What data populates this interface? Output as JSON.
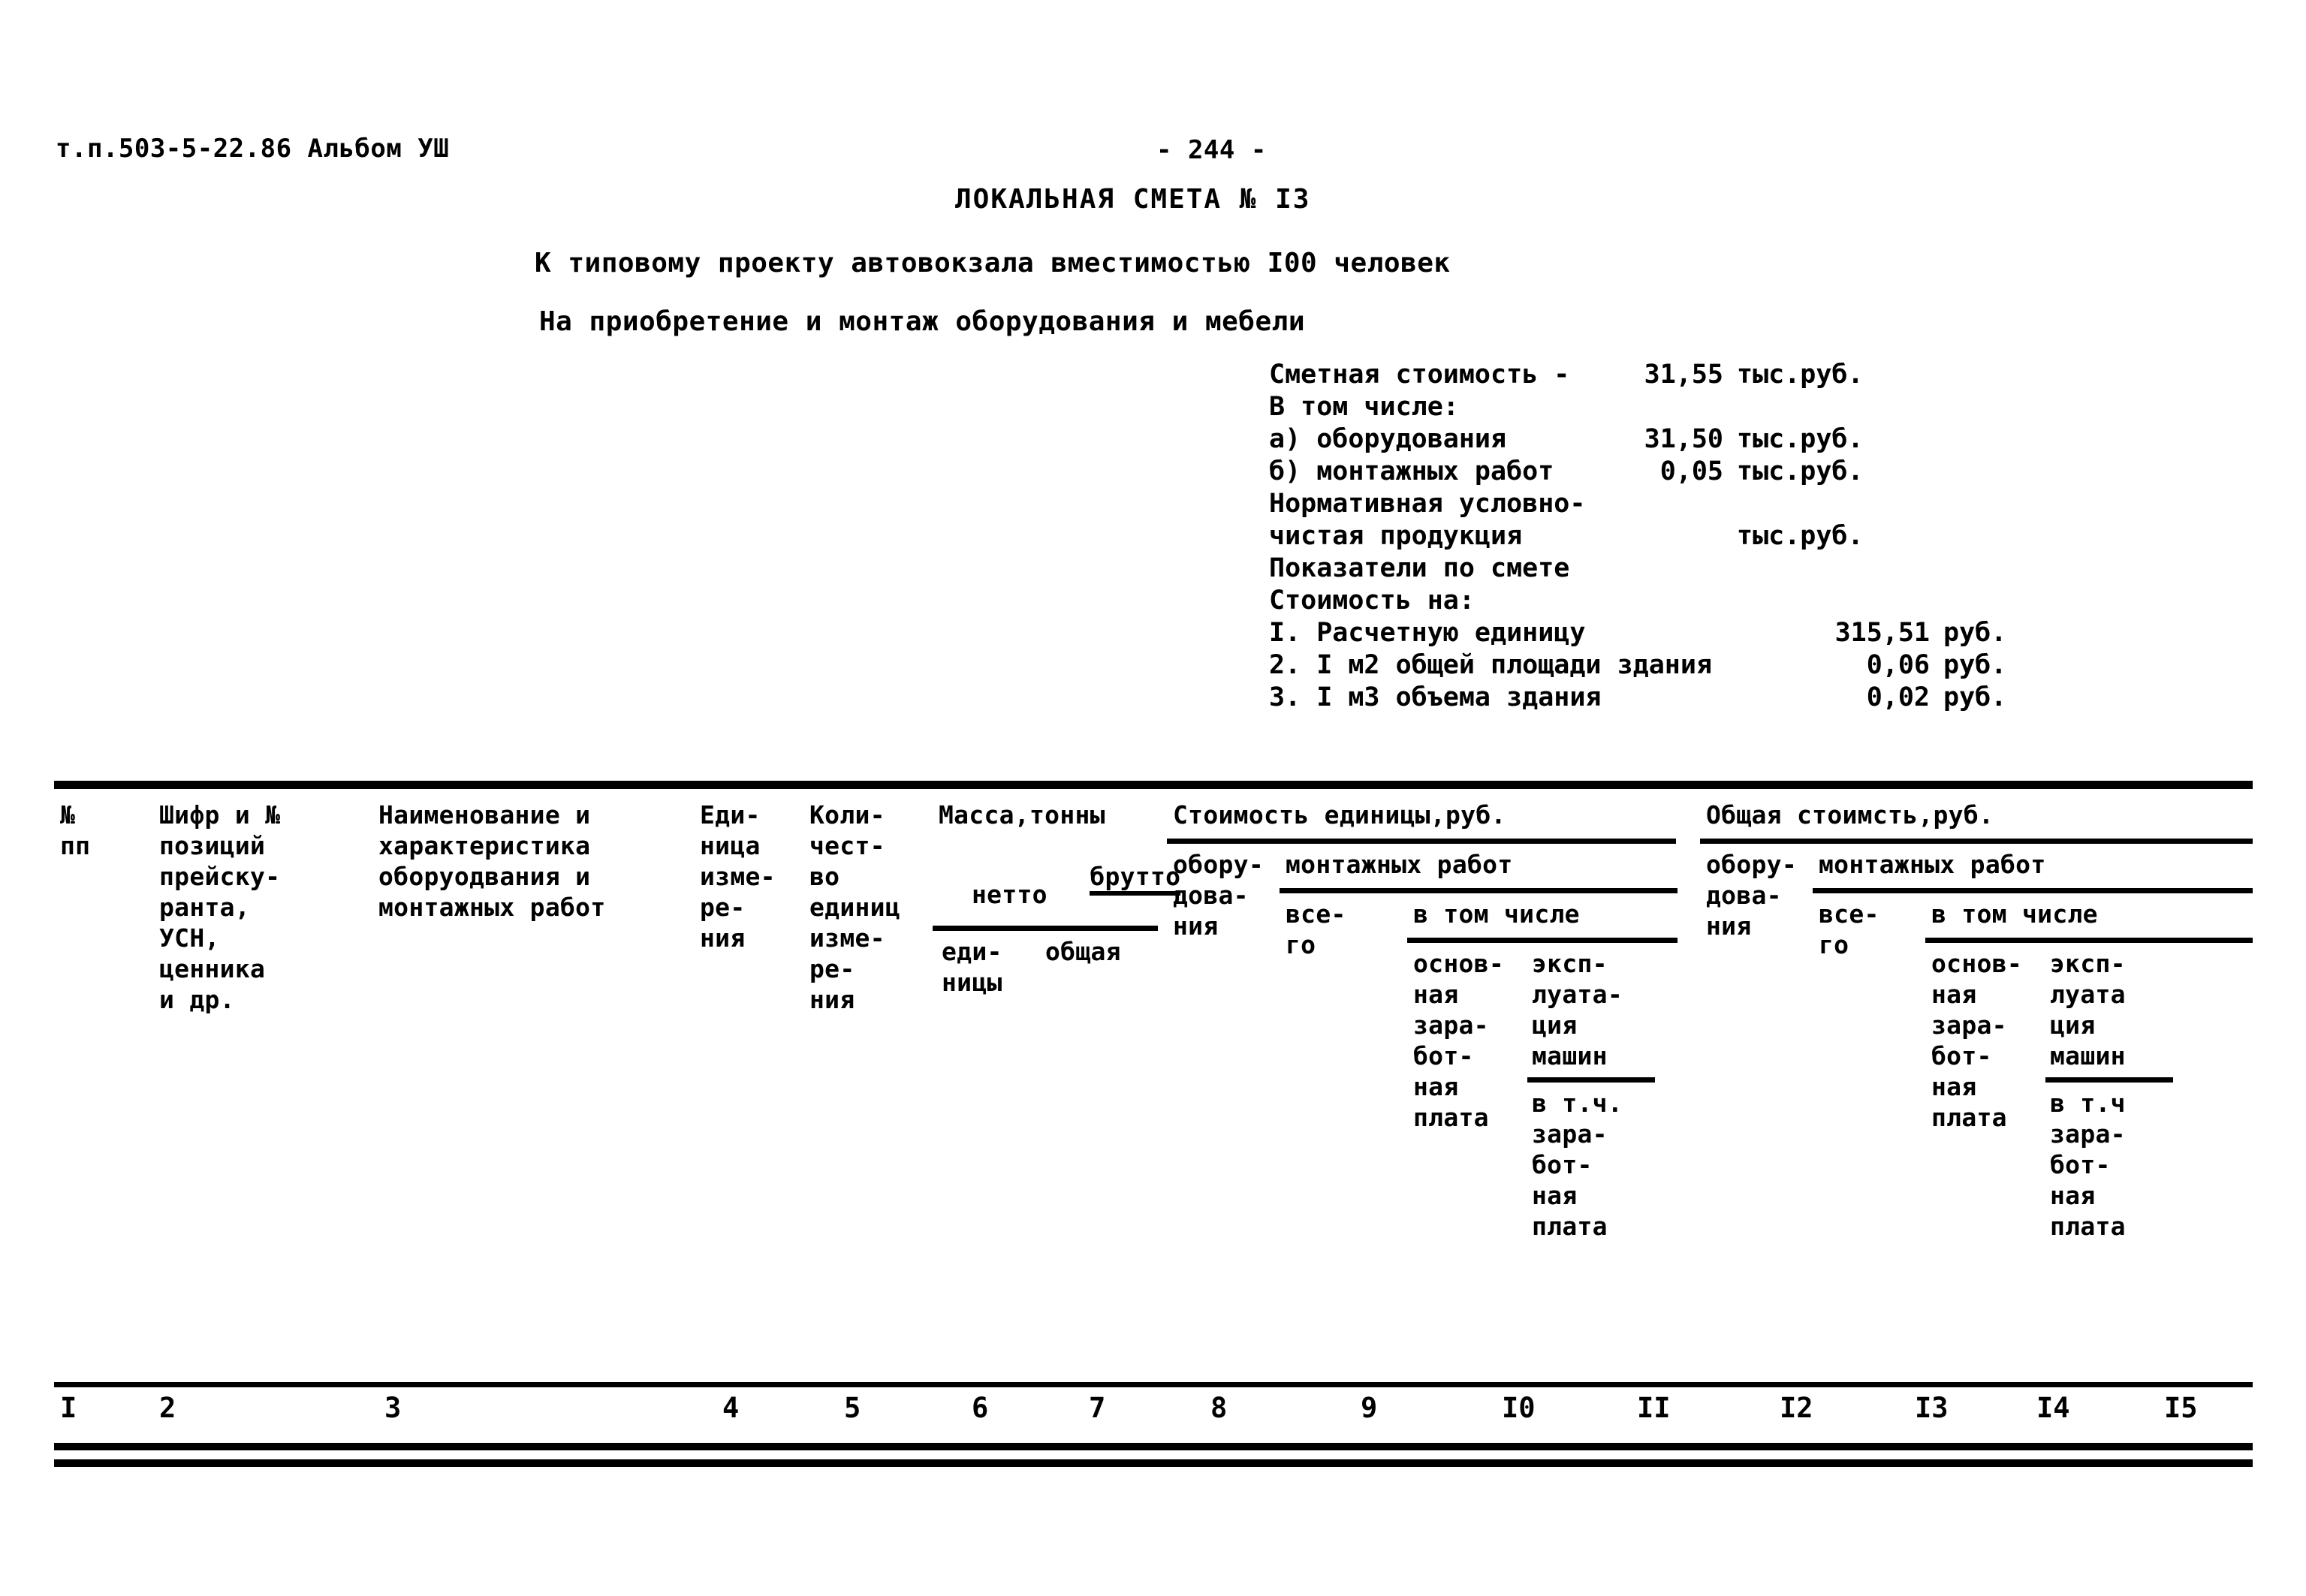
{
  "header": {
    "doc_ref": "т.п.503-5-22.86 Альбом УШ",
    "page_number": "- 244 -",
    "title": "ЛОКАЛЬНАЯ СМЕТА № I3",
    "subtitle_1": "К типовому проекту автовокзала вместимостью I00 человек",
    "subtitle_2": "На приобретение и монтаж оборудования и мебели"
  },
  "summary": {
    "total_label": "Сметная стоимость -",
    "total_value": "31,55",
    "total_unit": "тыс.руб.",
    "including_label": "В том числе:",
    "items": [
      {
        "label": "а) оборудования",
        "value": "31,50",
        "unit": "тыс.руб."
      },
      {
        "label": "б) монтажных работ",
        "value": "0,05",
        "unit": "тыс.руб."
      }
    ],
    "nucp_label_line1": "Нормативная условно-",
    "nucp_label_line2": "чистая продукция",
    "nucp_value": "",
    "nucp_unit": "тыс.руб.",
    "indicators_heading": "Показатели по смете",
    "indicators_subheading": "Стоимость на:",
    "indicators": [
      {
        "label": "I. Расчетную единицу",
        "value": "315,51",
        "unit": "руб."
      },
      {
        "label": "2. I м2 общей площади здания",
        "value": "0,06",
        "unit": "руб."
      },
      {
        "label": "3. I м3 объема здания",
        "value": "0,02",
        "unit": "руб."
      }
    ]
  },
  "table": {
    "col1_line1": "№",
    "col1_line2": "пп",
    "col2": "Шифр и №\nпозиций\nпрейску-\nранта,\nУСН,\nценника\nи др.",
    "col3": "Наименование и\nхарактеристика\nоборуодвания и\nмонтажных работ",
    "col4": "Еди-\nница\nизме-\nре-\nния",
    "col5": "Коли-\nчест-\nво\nединиц\nизме-\nре-\nния",
    "mass_title": "Масса,тонны",
    "mass_brutto": "брутто",
    "mass_netto": "нетто",
    "mass_unit": "еди-\nницы",
    "mass_total": "общая",
    "unit_cost_title": "Стоимость единицы,руб.",
    "unit_cost_equipment": "обору-\nдова-\nния",
    "unit_cost_install": "монтажных работ",
    "unit_cost_all": "все-\nго",
    "unit_cost_including": "в том числе",
    "unit_cost_basic_wage": "основ-\nная\nзара-\nбот-\nная\nплата",
    "unit_cost_machines": "эксп-\nлуата-\nция\nмашин",
    "unit_cost_wage_within": "в т.ч.\nзара-\nбот-\nная\nплата",
    "total_cost_title": "Общая стоимсть,руб.",
    "total_cost_equipment": "обору-\nдова-\nния",
    "total_cost_install": "монтажных работ",
    "total_cost_all": "все-\nго",
    "total_cost_including": "в том числе",
    "total_cost_basic_wage": "основ-\nная\nзара-\nбот-\nная\nплата",
    "total_cost_machines": "эксп-\nлуата\nция\nмашин",
    "total_cost_wage_within": "в т.ч\nзара-\nбот-\nная\nплата",
    "column_numbers": [
      "I",
      "2",
      "3",
      "4",
      "5",
      "6",
      "7",
      "8",
      "9",
      "I0",
      "II",
      "I2",
      "I3",
      "I4",
      "I5"
    ]
  }
}
